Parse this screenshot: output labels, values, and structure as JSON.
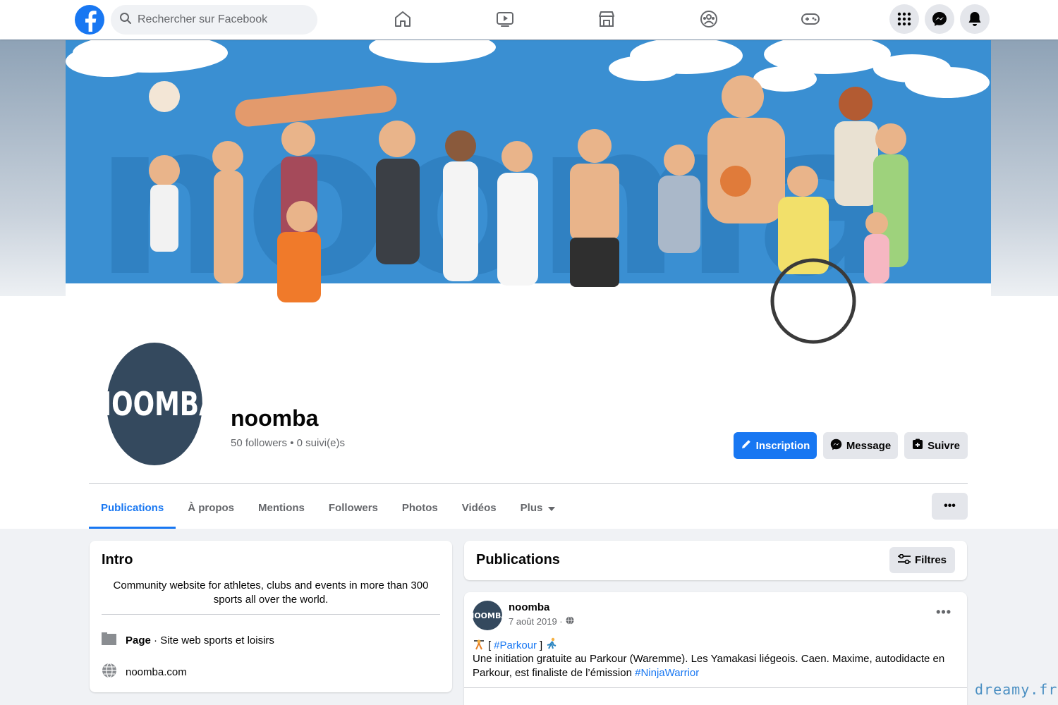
{
  "topbar": {
    "search_placeholder": "Rechercher sur Facebook",
    "nav_icons": [
      "home-icon",
      "watch-icon",
      "marketplace-icon",
      "groups-icon",
      "gaming-icon"
    ],
    "right_icons": [
      "menu-grid-icon",
      "messenger-icon",
      "notifications-icon"
    ]
  },
  "profile": {
    "avatar_text": "NOOMBA",
    "name": "noomba",
    "stats": "50 followers • 0 suivi(e)s",
    "buttons": {
      "primary": "Inscription",
      "message": "Message",
      "follow": "Suivre"
    }
  },
  "tabs": [
    {
      "label": "Publications",
      "active": true
    },
    {
      "label": "À propos"
    },
    {
      "label": "Mentions"
    },
    {
      "label": "Followers"
    },
    {
      "label": "Photos"
    },
    {
      "label": "Vidéos"
    },
    {
      "label": "Plus"
    }
  ],
  "more_label": "•••",
  "intro": {
    "title": "Intro",
    "bio": "Community website for athletes, clubs and events in more than 300 sports all over the world.",
    "page_label": "Page",
    "page_category": " · Site web sports et loisirs",
    "website": "noomba.com"
  },
  "publications": {
    "title": "Publications",
    "filter_label": "Filtres"
  },
  "post": {
    "avatar_text": "NOOMBA",
    "author": "noomba",
    "date": "7 août 2019 ·",
    "dots": "•••",
    "tag_open": "[ ",
    "tag": "#Parkour",
    "tag_close": " ]",
    "text_main": "Une initiation gratuite au Parkour (Waremme). Les Yamakasi liégeois. Caen. Maxime, autodidacte en Parkour, est finaliste de l’émission ",
    "text_link": "#NinjaWarrior"
  },
  "watermark": "dreamy.fr",
  "colors": {
    "brand": "#1877f2",
    "avatar_bg": "#34495e",
    "cover_sky": "#3a8fd2"
  }
}
